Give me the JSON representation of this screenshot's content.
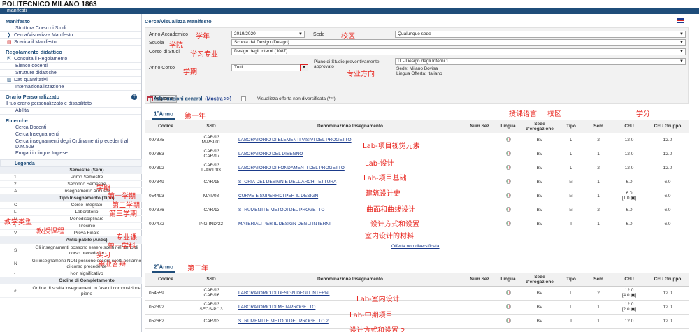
{
  "header": {
    "brand": "POLITECNICO MILANO 1863",
    "nav": "manifesti"
  },
  "sidebar": {
    "manifesto": {
      "title": "Manifesto",
      "items": [
        "Struttura Corso di Studi",
        "Cerca/Visualizza Manifesto",
        "Scarica il Manifesto"
      ]
    },
    "regolamento": {
      "title": "Regolamento didattico",
      "items": [
        "Consulta il Regolamento",
        "Elenco docenti",
        "Strutture didattiche",
        "Dati quantitativi",
        "Internazionalizzazione"
      ]
    },
    "orario": {
      "title": "Orario Personalizzato",
      "items": [
        "Il tuo orario personalizzato e disabilitato",
        "Abilita"
      ]
    },
    "ricerche": {
      "title": "Ricerche",
      "items": [
        "Cerca Docenti",
        "Cerca Insegnamenti",
        "Cerca insegnamenti degli Ordinamenti precedenti al D.M.509",
        "Erogati in lingua Inglese"
      ]
    }
  },
  "legend": {
    "title": "Legenda",
    "sem_header": "Semestre (Sem)",
    "sem": [
      {
        "k": "1",
        "v": "Primo Semestre"
      },
      {
        "k": "2",
        "v": "Secondo Semestre"
      },
      {
        "k": "A",
        "v": "Insegnamento Annuale"
      }
    ],
    "tipo_header": "Tipo Insegnamento (Tipo)",
    "tipo": [
      {
        "k": "C",
        "v": "Corso Integrato"
      },
      {
        "k": "L",
        "v": "Laboratorio"
      },
      {
        "k": "M",
        "v": "Monodisciplinare"
      },
      {
        "k": "T",
        "v": "Tirocinio"
      },
      {
        "k": "V",
        "v": "Prova Finale"
      }
    ],
    "antic_header": "Anticipabile (Antic)",
    "antic": [
      {
        "k": "S",
        "v": "Gli insegnamenti possono essere scelti nell'anno di corso precedente"
      },
      {
        "k": "N",
        "v": "Gli insegnamenti NON possono essere scelti nell'anno di corso precedente"
      },
      {
        "k": "-",
        "v": "Non significativo"
      }
    ],
    "ordine_header": "Ordine di Completamento",
    "ordine": [
      {
        "k": "#",
        "v": "Ordine di scelta insegnamenti in fase di composizione piano"
      }
    ]
  },
  "main": {
    "title": "Cerca/Visualizza Manifesto",
    "form": {
      "anno_label": "Anno Accademico",
      "anno_value": "2019/2020",
      "sede_label": "Sede",
      "sede_value": "Qualunque sede",
      "scuola_label": "Scuola",
      "scuola_value": "Scuola del Design (Design)",
      "corso_label": "Corso di Studi",
      "corso_value": "Design degli Interni (1087)",
      "annocorso_label": "Anno Corso",
      "annocorso_value": "Tutti",
      "piano_label": "Piano di Studio preventivamente approvato",
      "piano_value": "IT - Design degli Interni 1",
      "piano_sede": "Sede: Milano Bovisa",
      "piano_lingua": "Lingua Offerta: Italiano",
      "aggiorna": "Aggiorna",
      "chk_label": "Visualizza offerta non diversificata (***)"
    },
    "info_generali": "Informazioni generali",
    "info_link": "(Mostra >>)",
    "columns": [
      "Codice",
      "SSD",
      "Denominazione Insegnamento",
      "Num Sez",
      "Lingua",
      "Sede d'erogazione",
      "Tipo",
      "Sem",
      "CFU",
      "CFU Gruppo"
    ],
    "year1": {
      "label_num": "1",
      "label_sup": "o",
      "label_text": "Anno",
      "rows": [
        {
          "code": "097375",
          "ssd1": "ICAR/13",
          "ssd2": "M-PSI/01",
          "name": "LABORATORIO DI ELEMENTI VISIVI DEL PROGETTO",
          "sede": "BV",
          "tipo": "L",
          "sem": "2",
          "cfu": "12.0",
          "cfu2": "",
          "cfug": "12.0"
        },
        {
          "code": "097363",
          "ssd1": "ICAR/13",
          "ssd2": "ICAR/17",
          "name": "LABORATORIO DEL DISEGNO",
          "sede": "BV",
          "tipo": "L",
          "sem": "1",
          "cfu": "12.0",
          "cfu2": "",
          "cfug": "12.0"
        },
        {
          "code": "097392",
          "ssd1": "ICAR/13",
          "ssd2": "L-ART/03",
          "name": "LABORATORIO DI FONDAMENTI DEL PROGETTO",
          "sede": "BV",
          "tipo": "L",
          "sem": "2",
          "cfu": "12.0",
          "cfu2": "",
          "cfug": "12.0"
        },
        {
          "code": "097349",
          "ssd1": "ICAR/18",
          "ssd2": "",
          "name": "STORIA DEL DESIGN E DELL'ARCHITETTURA",
          "sede": "BV",
          "tipo": "M",
          "sem": "1",
          "cfu": "6.0",
          "cfu2": "",
          "cfug": "6.0"
        },
        {
          "code": "054493",
          "ssd1": "MAT/08",
          "ssd2": "",
          "name": "CURVE E SUPERFICI PER IL DESIGN",
          "sede": "BV",
          "tipo": "M",
          "sem": "1",
          "cfu": "6.0",
          "cfu2": "[1.0 ▣]",
          "cfug": "6.0"
        },
        {
          "code": "097376",
          "ssd1": "ICAR/13",
          "ssd2": "",
          "name": "STRUMENTI E METODI DEL PROGETTO",
          "sede": "BV",
          "tipo": "M",
          "sem": "2",
          "cfu": "6.0",
          "cfu2": "",
          "cfug": "6.0"
        },
        {
          "code": "097472",
          "ssd1": "ING-IND/22",
          "ssd2": "",
          "name": "MATERIALI PER IL DESIGN DEGLI INTERNI",
          "sede": "BV",
          "tipo": "I",
          "sem": "1",
          "cfu": "6.0",
          "cfu2": "",
          "cfug": "6.0"
        }
      ],
      "offerta": "Offerta non diversificata"
    },
    "year2": {
      "label_num": "2",
      "label_sup": "o",
      "label_text": "Anno",
      "rows": [
        {
          "code": "054559",
          "ssd1": "ICAR/13",
          "ssd2": "ICAR/16",
          "name": "LABORATORIO DI DESIGN DEGLI INTERNI",
          "sede": "BV",
          "tipo": "L",
          "sem": "2",
          "cfu": "12.0",
          "cfu2": "[4.0 ▣]",
          "cfug": "12.0"
        },
        {
          "code": "052892",
          "ssd1": "ICAR/13",
          "ssd2": "SECS-P/13",
          "name": "LABORATORIO DI METAPROGETTO",
          "sede": "BV",
          "tipo": "L",
          "sem": "1",
          "cfu": "12.0",
          "cfu2": "[2.0 ▣]",
          "cfug": "12.0"
        },
        {
          "code": "052662",
          "ssd1": "ICAR/13",
          "ssd2": "",
          "name": "STRUMENTI E METODI DEL PROGETTO 2",
          "sede": "BV",
          "tipo": "I",
          "sem": "1",
          "cfu": "12.0",
          "cfu2": "",
          "cfug": "12.0"
        }
      ]
    }
  },
  "annotations": {
    "anno": "学年",
    "sede": "校区",
    "scuola": "学院",
    "corso": "学习专业",
    "annocorso": "学期",
    "piano": "专业方向",
    "lingua": "授课语言",
    "sede_er": "校区",
    "cfu": "学分",
    "year1": "第一年",
    "year2": "第二年",
    "r1": "Lab-项目视觉元素",
    "r2": "Lab-设计",
    "r3": "Lab-项目基础",
    "r4": "建筑设计史",
    "r5": "曲面和曲线设计",
    "r6": "设计方式和设置",
    "r7": "室内设计的材料",
    "r8": "Lab-室内设计",
    "r9": "Lab-中期项目",
    "r10": "设计方式和设置 2",
    "sem": "学期",
    "sem1": "第一学期",
    "sem2": "第二学期",
    "sem3": "第三学期",
    "tipo": "教学类型",
    "ci": "教授课程",
    "lab": "专业课",
    "mono": "单一学科",
    "tiro": "实习",
    "finale": "毕业答辩"
  }
}
